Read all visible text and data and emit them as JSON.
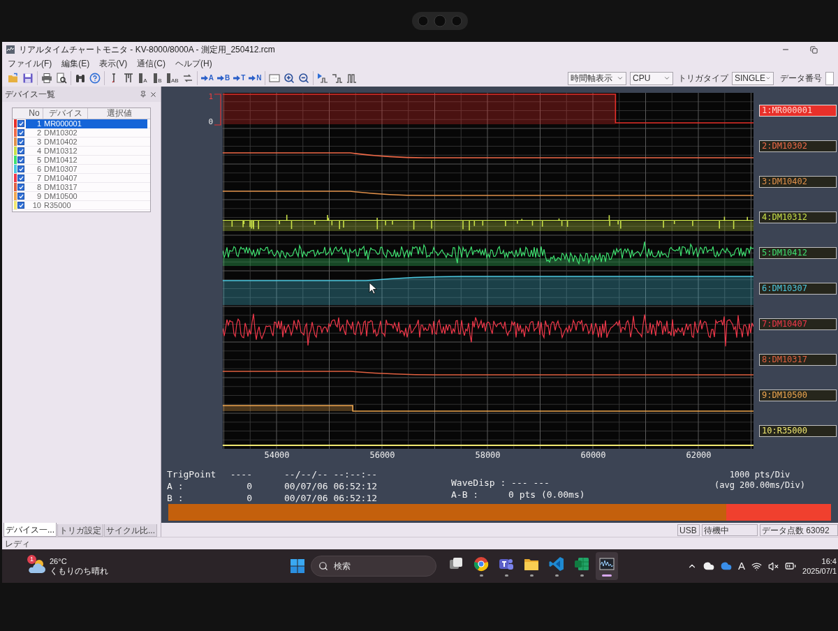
{
  "window": {
    "title": "リアルタイムチャートモニタ - KV-8000/8000A - 測定用_250412.rcm"
  },
  "menu": [
    "ファイル(F)",
    "編集(E)",
    "表示(V)",
    "通信(C)",
    "ヘルプ(H)"
  ],
  "toolbar": {
    "groups": [
      {
        "tools": [
          {
            "kind": "open"
          },
          {
            "kind": "save"
          }
        ]
      },
      {
        "tools": [
          {
            "kind": "print"
          },
          {
            "kind": "preview"
          }
        ]
      },
      {
        "tools": [
          {
            "kind": "find"
          },
          {
            "kind": "help"
          }
        ]
      },
      {
        "tools": [
          {
            "kind": "cursor_line"
          },
          {
            "kind": "cursor_pair"
          },
          {
            "kind": "cursor",
            "label": "A"
          },
          {
            "kind": "cursor",
            "label": "B"
          },
          {
            "kind": "cursor",
            "label": "AB"
          },
          {
            "kind": "swap"
          }
        ]
      },
      {
        "tools": [
          {
            "kind": "jump",
            "label": "A"
          },
          {
            "kind": "jump",
            "label": "B"
          },
          {
            "kind": "jump",
            "label": "T"
          },
          {
            "kind": "jump",
            "label": "N"
          }
        ]
      },
      {
        "tools": [
          {
            "kind": "fit"
          },
          {
            "kind": "zoom_in"
          },
          {
            "kind": "zoom_out"
          }
        ]
      },
      {
        "tools": [
          {
            "kind": "trigger_start"
          },
          {
            "kind": "trigger_step"
          },
          {
            "kind": "trigger_multi"
          }
        ]
      }
    ],
    "view_mode": "時間軸表示",
    "source": "CPU",
    "trigger_type_label": "トリガタイプ",
    "trigger_type": "SINGLE",
    "data_number_label": "データ番号"
  },
  "device_panel": {
    "title": "デバイス一覧",
    "columns": [
      "No",
      "デバイス",
      "選択値"
    ],
    "rows": [
      {
        "no": "1",
        "device": "MR000001",
        "checked": true,
        "selected": true,
        "color": "#e8302a"
      },
      {
        "no": "2",
        "device": "DM10302",
        "checked": true,
        "selected": false,
        "color": "#f06a48"
      },
      {
        "no": "3",
        "device": "DM10402",
        "checked": true,
        "selected": false,
        "color": "#e0904a"
      },
      {
        "no": "4",
        "device": "DM10312",
        "checked": true,
        "selected": false,
        "color": "#c8e048"
      },
      {
        "no": "5",
        "device": "DM10412",
        "checked": true,
        "selected": false,
        "color": "#3ee070"
      },
      {
        "no": "6",
        "device": "DM10307",
        "checked": true,
        "selected": false,
        "color": "#4cc8e0"
      },
      {
        "no": "7",
        "device": "DM10407",
        "checked": true,
        "selected": false,
        "color": "#f0384a"
      },
      {
        "no": "8",
        "device": "DM10317",
        "checked": true,
        "selected": false,
        "color": "#e06040"
      },
      {
        "no": "9",
        "device": "DM10500",
        "checked": true,
        "selected": false,
        "color": "#f0a850"
      },
      {
        "no": "10",
        "device": "R35000",
        "checked": true,
        "selected": false,
        "color": "#f0e870"
      }
    ],
    "tabs": [
      {
        "label": "デバイス一...",
        "selected": true
      },
      {
        "label": "トリガ設定",
        "selected": false
      },
      {
        "label": "サイクル比...",
        "selected": false
      }
    ]
  },
  "chart": {
    "scale_labels": [
      "1",
      "0"
    ],
    "channels": [
      {
        "label": "1:MR000001",
        "color": "#e8302a",
        "selected": true,
        "kind": "step"
      },
      {
        "label": "2:DM10302",
        "color": "#f06a48",
        "selected": false,
        "kind": "ramp_down"
      },
      {
        "label": "3:DM10402",
        "color": "#e0904a",
        "selected": false,
        "kind": "ramp_down"
      },
      {
        "label": "4:DM10312",
        "color": "#c8e048",
        "selected": false,
        "kind": "spiky"
      },
      {
        "label": "5:DM10412",
        "color": "#3ee070",
        "selected": false,
        "kind": "noisy"
      },
      {
        "label": "6:DM10307",
        "color": "#4cc8e0",
        "selected": false,
        "kind": "ramp_up"
      },
      {
        "label": "7:DM10407",
        "color": "#f0384a",
        "selected": false,
        "kind": "noisy"
      },
      {
        "label": "8:DM10317",
        "color": "#e06040",
        "selected": false,
        "kind": "ramp_down"
      },
      {
        "label": "9:DM10500",
        "color": "#f0a850",
        "selected": false,
        "kind": "step"
      },
      {
        "label": "10:R35000",
        "color": "#f0e870",
        "selected": false,
        "kind": "flat"
      }
    ],
    "x_ticks": [
      "54000",
      "56000",
      "58000",
      "60000",
      "62000"
    ]
  },
  "cursor_info": {
    "rows": [
      {
        "label": "TrigPoint",
        "value": "----",
        "time": "--/--/-- --:--:--"
      },
      {
        "label": "A :",
        "value": "0",
        "time": "00/07/06 06:52:12"
      },
      {
        "label": "B :",
        "value": "0",
        "time": "00/07/06 06:52:12"
      }
    ],
    "wave_disp": "WaveDisp : --- ---",
    "diff_label": "A-B :",
    "diff_value": "0 pts (0.00ms)",
    "div_scale": "1000 pts/Div",
    "div_time": "(avg 200.00ms/Div)"
  },
  "status_bar": {
    "fields": [
      "USB",
      "待機中",
      "データ点数 63092"
    ],
    "message": "レディ"
  },
  "taskbar": {
    "weather": {
      "badge": "1",
      "temperature": "26°C",
      "forecast": "くもりのち晴れ"
    },
    "search": {
      "placeholder": "検索"
    },
    "apps": [
      {
        "kind": "task_view",
        "running": false,
        "selected": false
      },
      {
        "kind": "browser",
        "running": true,
        "selected": false
      },
      {
        "kind": "chat",
        "running": true,
        "selected": false
      },
      {
        "kind": "files",
        "running": true,
        "selected": false
      },
      {
        "kind": "editor",
        "running": true,
        "selected": false
      },
      {
        "kind": "spreadsheet",
        "running": true,
        "selected": false
      },
      {
        "kind": "monitor",
        "running": true,
        "selected": true
      }
    ],
    "ime": "A",
    "time": "16:4",
    "date": "2025/07/1"
  }
}
